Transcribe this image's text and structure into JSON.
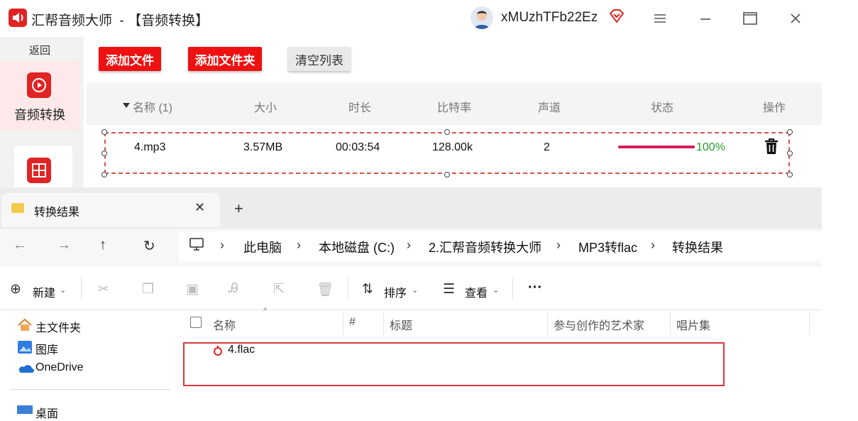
{
  "app": {
    "title": "汇帮音频大师  - 【音频转换】",
    "username": "xMUzhTFb22Ez",
    "brand_color": "#ee1111",
    "sidebar": {
      "back": "返回",
      "active_item": "音频转换"
    },
    "toolbar": {
      "add_file": "添加文件",
      "add_folder": "添加文件夹",
      "clear_list": "清空列表"
    },
    "list": {
      "columns": {
        "name": "名称 (1)",
        "size": "大小",
        "duration": "时长",
        "bitrate": "比特率",
        "channels": "声道",
        "status": "状态",
        "action": "操作"
      },
      "rows": [
        {
          "name": "4.mp3",
          "size": "3.57MB",
          "duration": "00:03:54",
          "bitrate": "128.00k",
          "channels": "2",
          "progress": 1.0,
          "progress_text": "100%"
        }
      ]
    }
  },
  "explorer": {
    "tab": {
      "label": "转换结果"
    },
    "breadcrumb": [
      "此电脑",
      "本地磁盘 (C:)",
      "2.汇帮音频转换大师",
      "MP3转flac",
      "转换结果"
    ],
    "commands": {
      "new": "新建",
      "sort": "排序",
      "view": "查看",
      "more": "···"
    },
    "nav_pane": {
      "home": "主文件夹",
      "gallery": "图库",
      "onedrive": "OneDrive",
      "desktop": "桌面"
    },
    "columns": {
      "name": "名称",
      "number": "#",
      "title": "标题",
      "artist": "参与创作的艺术家",
      "album": "唱片集"
    },
    "files": [
      {
        "name": "4.flac"
      }
    ]
  }
}
